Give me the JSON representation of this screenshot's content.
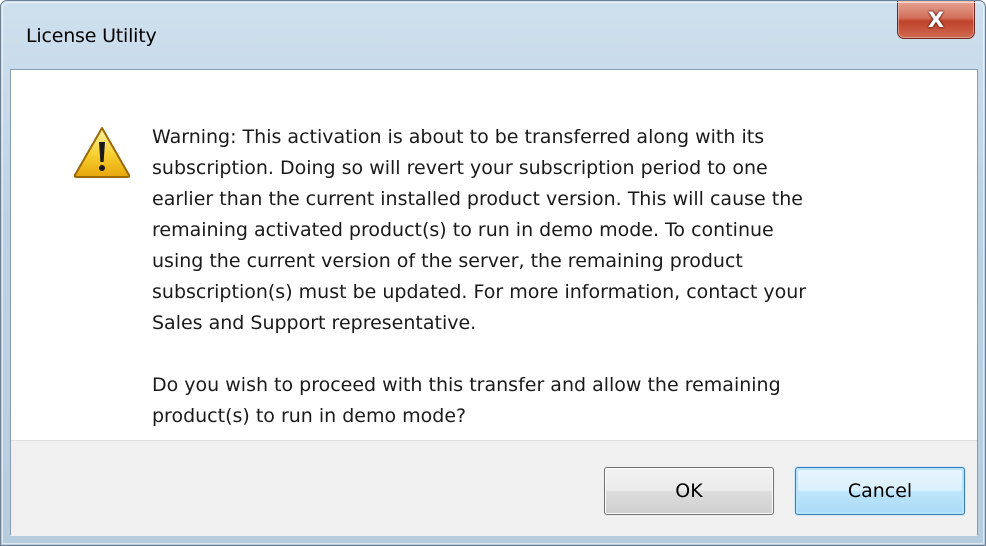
{
  "window": {
    "title": "License Utility",
    "close_icon": "close-icon",
    "close_glyph": "X",
    "close_color": "#c7412b"
  },
  "dialog": {
    "icon": "warning-icon",
    "message_lines": [
      "Warning: This activation is about to be transferred along with its",
      "subscription.  Doing so will revert your subscription period to one",
      "earlier than the current installed product version.  This will cause the",
      "remaining activated product(s) to run in demo mode.  To continue",
      "using the current version of the server, the remaining product",
      "subscription(s) must be updated.  For more information, contact your",
      "Sales and Support representative."
    ],
    "question_lines": [
      "Do you wish to proceed with this transfer and allow the remaining",
      "product(s) to run in demo mode?"
    ]
  },
  "buttons": {
    "ok_label": "OK",
    "cancel_label": "Cancel",
    "default_button": "Cancel",
    "focus_color": "#3c7fb1"
  }
}
